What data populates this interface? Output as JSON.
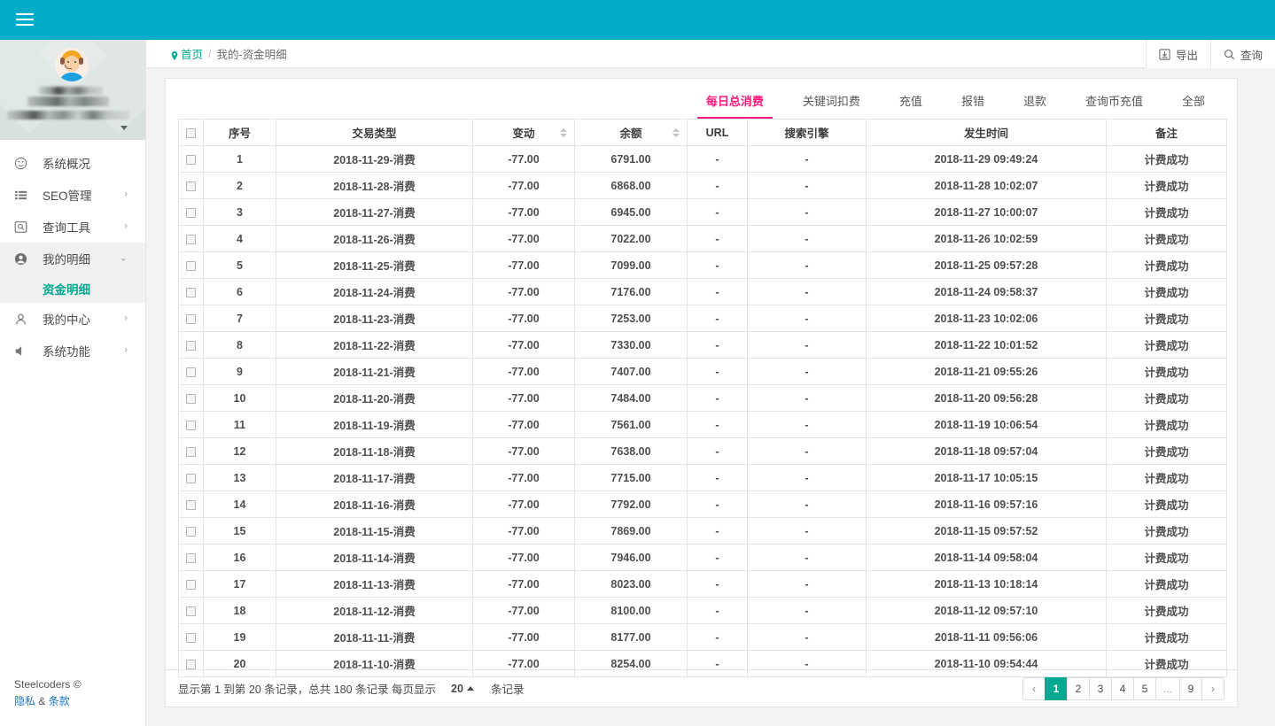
{
  "topbar": {
    "menu_toggle_icon": "hamburger-icon"
  },
  "sidebar": {
    "profile": {
      "avatar_icon": "user-avatar-headset",
      "caret_icon": "caret-down-icon",
      "username_redacted": "",
      "details_redacted": ""
    },
    "items": [
      {
        "label": "系统概况",
        "icon": "dashboard-icon",
        "arrow": "",
        "active": false
      },
      {
        "label": "SEO管理",
        "icon": "list-icon",
        "arrow": "›",
        "active": false
      },
      {
        "label": "查询工具",
        "icon": "search-box-icon",
        "arrow": "›",
        "active": false
      },
      {
        "label": "我的明细",
        "icon": "user-circle-icon",
        "arrow": "⌄",
        "active": true
      },
      {
        "label": "我的中心",
        "icon": "person-icon",
        "arrow": "›",
        "active": false
      },
      {
        "label": "系统功能",
        "icon": "speaker-icon",
        "arrow": "›",
        "active": false
      }
    ],
    "submenu": {
      "label": "资金明细"
    },
    "footer": {
      "copyright": "Steelcoders ©",
      "privacy": "隐私",
      "amp": "&",
      "terms": "条款"
    }
  },
  "breadcrumb": {
    "home": "首页",
    "separator": "/",
    "current": "我的-资金明细",
    "pin_icon": "location-pin-icon"
  },
  "toolbar": {
    "export_label": "导出",
    "export_icon": "export-icon",
    "search_label": "查询",
    "search_icon": "search-icon"
  },
  "tabs": [
    {
      "label": "每日总消费",
      "active": true
    },
    {
      "label": "关键词扣费",
      "active": false
    },
    {
      "label": "充值",
      "active": false
    },
    {
      "label": "报错",
      "active": false
    },
    {
      "label": "退款",
      "active": false
    },
    {
      "label": "查询币充值",
      "active": false
    },
    {
      "label": "全部",
      "active": false
    }
  ],
  "table": {
    "columns": [
      {
        "key": "chk",
        "label": "",
        "sortable": false
      },
      {
        "key": "seq",
        "label": "序号",
        "sortable": false
      },
      {
        "key": "type",
        "label": "交易类型",
        "sortable": false
      },
      {
        "key": "change",
        "label": "变动",
        "sortable": true
      },
      {
        "key": "balance",
        "label": "余额",
        "sortable": true
      },
      {
        "key": "url",
        "label": "URL",
        "sortable": false
      },
      {
        "key": "engine",
        "label": "搜索引擎",
        "sortable": false
      },
      {
        "key": "time",
        "label": "发生时间",
        "sortable": false
      },
      {
        "key": "note",
        "label": "备注",
        "sortable": false
      }
    ],
    "rows": [
      {
        "seq": "1",
        "type": "2018-11-29-消费",
        "change": "-77.00",
        "balance": "6791.00",
        "url": "-",
        "engine": "-",
        "time": "2018-11-29 09:49:24",
        "note": "计费成功"
      },
      {
        "seq": "2",
        "type": "2018-11-28-消费",
        "change": "-77.00",
        "balance": "6868.00",
        "url": "-",
        "engine": "-",
        "time": "2018-11-28 10:02:07",
        "note": "计费成功"
      },
      {
        "seq": "3",
        "type": "2018-11-27-消费",
        "change": "-77.00",
        "balance": "6945.00",
        "url": "-",
        "engine": "-",
        "time": "2018-11-27 10:00:07",
        "note": "计费成功"
      },
      {
        "seq": "4",
        "type": "2018-11-26-消费",
        "change": "-77.00",
        "balance": "7022.00",
        "url": "-",
        "engine": "-",
        "time": "2018-11-26 10:02:59",
        "note": "计费成功"
      },
      {
        "seq": "5",
        "type": "2018-11-25-消费",
        "change": "-77.00",
        "balance": "7099.00",
        "url": "-",
        "engine": "-",
        "time": "2018-11-25 09:57:28",
        "note": "计费成功"
      },
      {
        "seq": "6",
        "type": "2018-11-24-消费",
        "change": "-77.00",
        "balance": "7176.00",
        "url": "-",
        "engine": "-",
        "time": "2018-11-24 09:58:37",
        "note": "计费成功"
      },
      {
        "seq": "7",
        "type": "2018-11-23-消费",
        "change": "-77.00",
        "balance": "7253.00",
        "url": "-",
        "engine": "-",
        "time": "2018-11-23 10:02:06",
        "note": "计费成功"
      },
      {
        "seq": "8",
        "type": "2018-11-22-消费",
        "change": "-77.00",
        "balance": "7330.00",
        "url": "-",
        "engine": "-",
        "time": "2018-11-22 10:01:52",
        "note": "计费成功"
      },
      {
        "seq": "9",
        "type": "2018-11-21-消费",
        "change": "-77.00",
        "balance": "7407.00",
        "url": "-",
        "engine": "-",
        "time": "2018-11-21 09:55:26",
        "note": "计费成功"
      },
      {
        "seq": "10",
        "type": "2018-11-20-消费",
        "change": "-77.00",
        "balance": "7484.00",
        "url": "-",
        "engine": "-",
        "time": "2018-11-20 09:56:28",
        "note": "计费成功"
      },
      {
        "seq": "11",
        "type": "2018-11-19-消费",
        "change": "-77.00",
        "balance": "7561.00",
        "url": "-",
        "engine": "-",
        "time": "2018-11-19 10:06:54",
        "note": "计费成功"
      },
      {
        "seq": "12",
        "type": "2018-11-18-消费",
        "change": "-77.00",
        "balance": "7638.00",
        "url": "-",
        "engine": "-",
        "time": "2018-11-18 09:57:04",
        "note": "计费成功"
      },
      {
        "seq": "13",
        "type": "2018-11-17-消费",
        "change": "-77.00",
        "balance": "7715.00",
        "url": "-",
        "engine": "-",
        "time": "2018-11-17 10:05:15",
        "note": "计费成功"
      },
      {
        "seq": "14",
        "type": "2018-11-16-消费",
        "change": "-77.00",
        "balance": "7792.00",
        "url": "-",
        "engine": "-",
        "time": "2018-11-16 09:57:16",
        "note": "计费成功"
      },
      {
        "seq": "15",
        "type": "2018-11-15-消费",
        "change": "-77.00",
        "balance": "7869.00",
        "url": "-",
        "engine": "-",
        "time": "2018-11-15 09:57:52",
        "note": "计费成功"
      },
      {
        "seq": "16",
        "type": "2018-11-14-消费",
        "change": "-77.00",
        "balance": "7946.00",
        "url": "-",
        "engine": "-",
        "time": "2018-11-14 09:58:04",
        "note": "计费成功"
      },
      {
        "seq": "17",
        "type": "2018-11-13-消费",
        "change": "-77.00",
        "balance": "8023.00",
        "url": "-",
        "engine": "-",
        "time": "2018-11-13 10:18:14",
        "note": "计费成功"
      },
      {
        "seq": "18",
        "type": "2018-11-12-消费",
        "change": "-77.00",
        "balance": "8100.00",
        "url": "-",
        "engine": "-",
        "time": "2018-11-12 09:57:10",
        "note": "计费成功"
      },
      {
        "seq": "19",
        "type": "2018-11-11-消费",
        "change": "-77.00",
        "balance": "8177.00",
        "url": "-",
        "engine": "-",
        "time": "2018-11-11 09:56:06",
        "note": "计费成功"
      },
      {
        "seq": "20",
        "type": "2018-11-10-消费",
        "change": "-77.00",
        "balance": "8254.00",
        "url": "-",
        "engine": "-",
        "time": "2018-11-10 09:54:44",
        "note": "计费成功"
      }
    ]
  },
  "pagination": {
    "info_text": "显示第 1 到第 20 条记录，总共 180 条记录 每页显示",
    "page_size": "20",
    "records_suffix": "条记录",
    "pages": [
      {
        "label": "‹",
        "type": "prev",
        "active": false
      },
      {
        "label": "1",
        "type": "page",
        "active": true
      },
      {
        "label": "2",
        "type": "page",
        "active": false
      },
      {
        "label": "3",
        "type": "page",
        "active": false
      },
      {
        "label": "4",
        "type": "page",
        "active": false
      },
      {
        "label": "5",
        "type": "page",
        "active": false
      },
      {
        "label": "...",
        "type": "dots",
        "active": false
      },
      {
        "label": "9",
        "type": "page",
        "active": false
      },
      {
        "label": "›",
        "type": "next",
        "active": false
      }
    ]
  },
  "colors": {
    "header_teal": "#00acc8",
    "accent_green": "#00a98f",
    "accent_pink": "#ff1b7e",
    "link_blue": "#1a73c8"
  }
}
